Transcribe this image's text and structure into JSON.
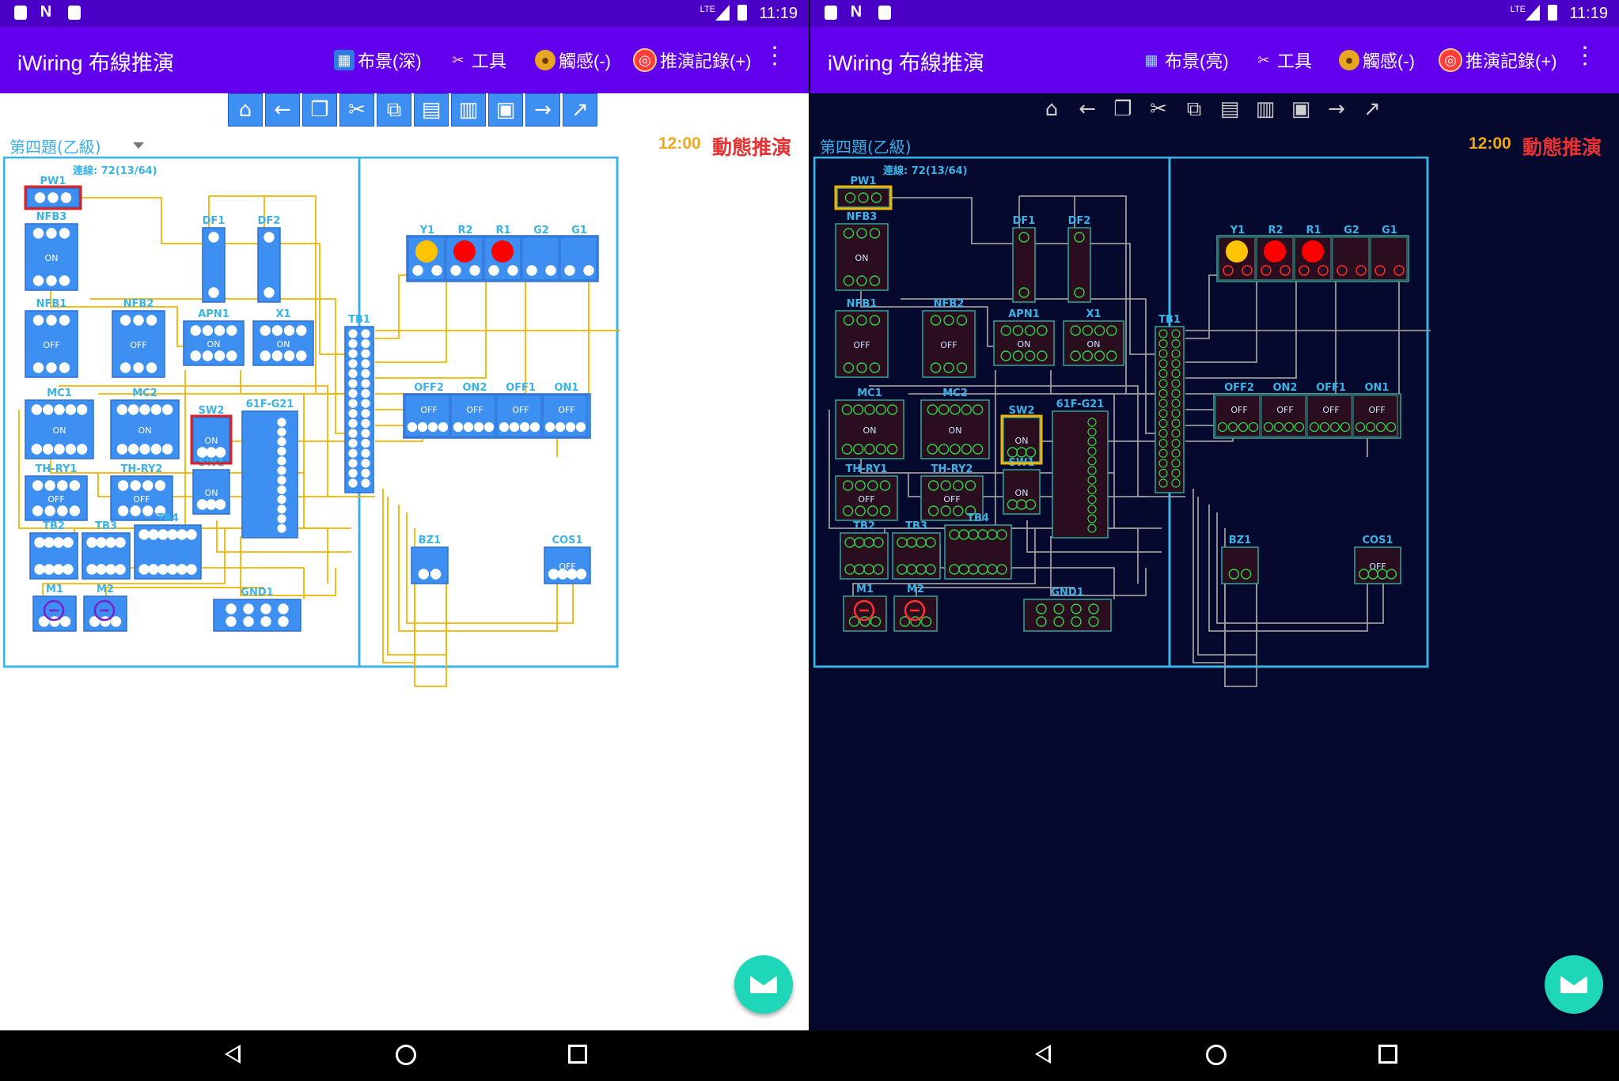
{
  "status_bar": {
    "time": "11:19",
    "signal": "LTE"
  },
  "app": {
    "title": "iWiring 布線推演"
  },
  "screens": [
    {
      "theme": "light",
      "actions": [
        "布景(深)",
        "工具",
        "觸感(-)",
        "推演記錄(+)"
      ],
      "question": "第四題(乙級)",
      "timer": "12:00",
      "mode": "動態推演",
      "connections": "連線: 72(13/64)"
    },
    {
      "theme": "dark",
      "actions": [
        "布景(亮)",
        "工具",
        "觸感(-)",
        "推演記錄(+)"
      ],
      "question": "第四題(乙級)",
      "timer": "12:00",
      "mode": "動態推演",
      "connections": "連線: 72(13/64)"
    }
  ],
  "toolbar_icons": [
    "home-icon",
    "back-arrow-icon",
    "copy-icon",
    "cut-icon",
    "duplicate-icon",
    "clipboard-icon",
    "delete-note-icon",
    "save-icon",
    "forward-arrow-icon",
    "expand-icon"
  ],
  "components": {
    "PW1": "PW1",
    "NFB3": "NFB3",
    "NFB1": "NFB1",
    "NFB2": "NFB2",
    "DF1": "DF1",
    "DF2": "DF2",
    "APN1": "APN1",
    "X1": "X1",
    "TB1": "TB1",
    "Y1": "Y1",
    "R2": "R2",
    "R1": "R1",
    "G2": "G2",
    "G1": "G1",
    "OFF2": "OFF2",
    "ON2": "ON2",
    "OFF1": "OFF1",
    "ON1": "ON1",
    "MC1": "MC1",
    "MC2": "MC2",
    "SW2": "SW2",
    "61F-G21": "61F-G21",
    "TH-RY1": "TH-RY1",
    "TH-RY2": "TH-RY2",
    "SW1": "SW1",
    "TB2": "TB2",
    "TB3": "TB3",
    "TB4": "TB4",
    "BZ1": "BZ1",
    "COS1": "COS1",
    "M1": "M1",
    "M2": "M2",
    "GND1": "GND1"
  },
  "labels": {
    "on": "ON",
    "off": "OFF"
  },
  "colors": {
    "light_block": "#3d8ff2",
    "dark_block": "#2a0d1e",
    "dark_border": "#2fa89a",
    "wire_light": "#f4b400",
    "wire_dark": "#9a9a9a",
    "frame": "#3ab3e6",
    "lamp_yellow": "#ffc400",
    "lamp_red": "#ff0000"
  }
}
